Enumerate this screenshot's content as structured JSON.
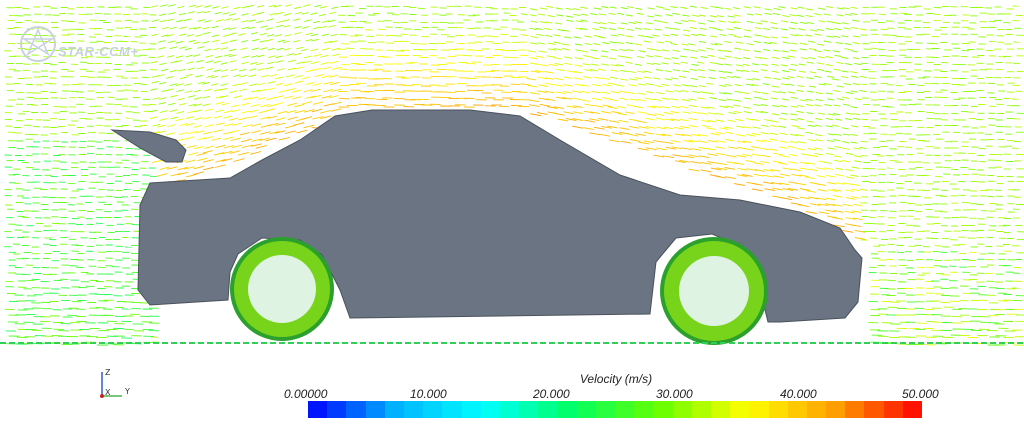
{
  "app": {
    "logo_text": "STAR-CCM+"
  },
  "axes": {
    "z": "Z",
    "x": "X",
    "y": "Y"
  },
  "legend": {
    "title": "Velocity (m/s)",
    "ticks": [
      "0.00000",
      "10.000",
      "20.000",
      "30.000",
      "40.000",
      "50.000"
    ],
    "min": 0,
    "max": 50,
    "num_colors": 32
  },
  "colors": {
    "body": "#6a7482",
    "body_outline": "#4a525c",
    "ground": "#2fd055",
    "colormap": [
      "#0000ff",
      "#00b4ff",
      "#00ffff",
      "#00ff66",
      "#66ff00",
      "#ffff00",
      "#ffa000",
      "#ff0000"
    ]
  }
}
